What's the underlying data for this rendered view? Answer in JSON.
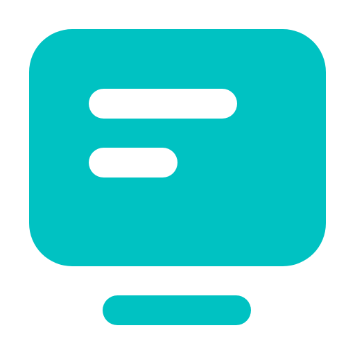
{
  "icon": {
    "name": "monitor-text-icon",
    "colors": {
      "primary": "#00C2C2",
      "background": "#FFFFFF",
      "line_fill": "#FFFFFF"
    }
  }
}
